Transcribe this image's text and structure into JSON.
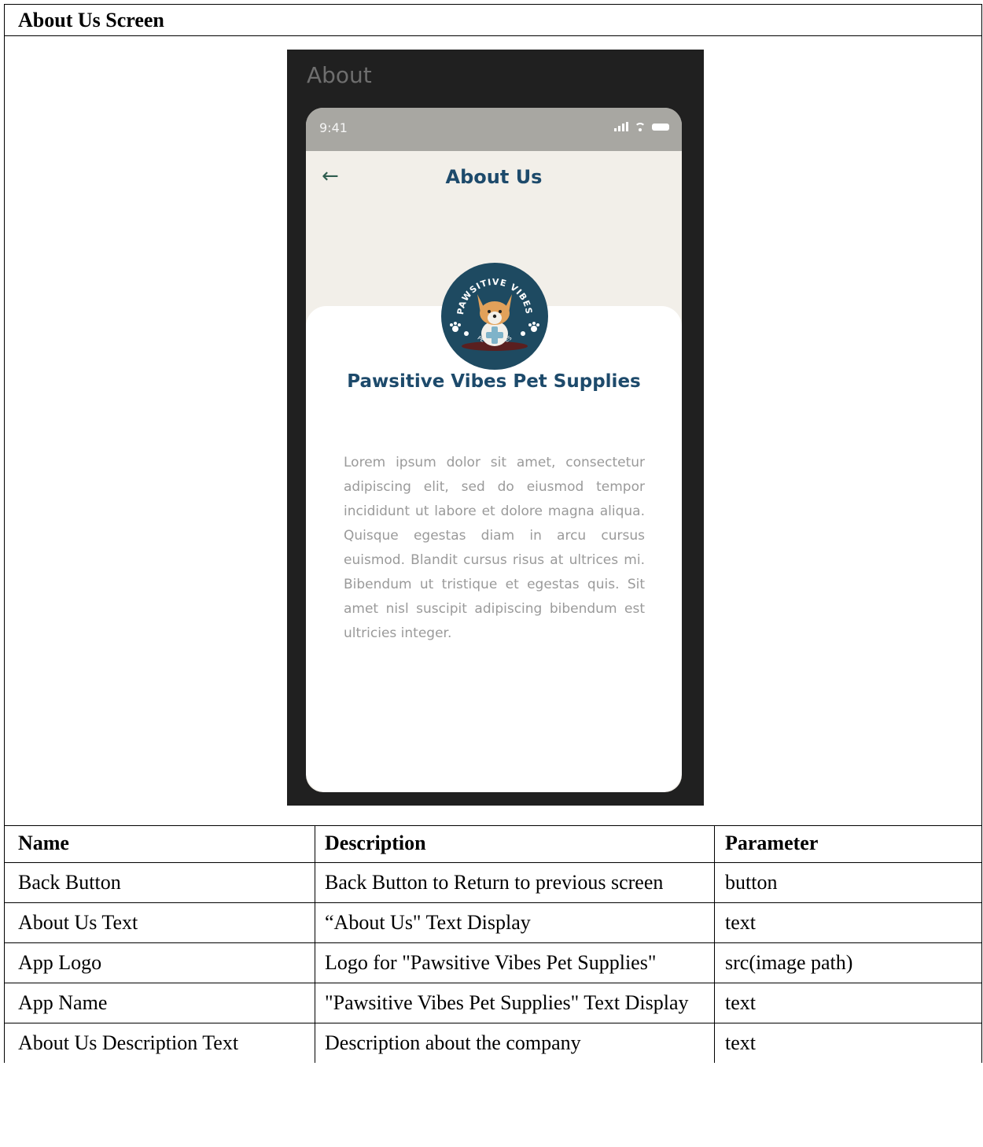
{
  "doc": {
    "title": "About Us Screen"
  },
  "mockup": {
    "frame_title": "About",
    "status_time": "9:41",
    "back_icon": "←",
    "nav_title": "About Us",
    "logo": {
      "icon": "pawsitive-vibes-logo",
      "top_text": "PAWSITIVE VIBES",
      "bottom_text": "PET SUPPLIES",
      "colors": {
        "circle": "#1e4a61",
        "dog": "#e2a15a"
      }
    },
    "app_name": "Pawsitive Vibes Pet Supplies",
    "description": "Lorem ipsum dolor sit amet, consectetur adipiscing elit, sed do eiusmod tempor incididunt ut labore et dolore magna aliqua. Quisque egestas diam in arcu cursus euismod. Blandit cursus risus at ultrices mi. Bibendum ut tristique et egestas quis. Sit amet nisl suscipit adipiscing bibendum est ultricies integer."
  },
  "table": {
    "headers": {
      "name": "Name",
      "description": "Description",
      "parameter": "Parameter"
    },
    "rows": [
      {
        "name": "Back Button",
        "description": "Back Button to Return to previous screen",
        "parameter": "button"
      },
      {
        "name": "About Us Text",
        "description": "“About Us\" Text Display",
        "parameter": "text"
      },
      {
        "name": "App Logo",
        "description": "Logo for \"Pawsitive Vibes Pet Supplies\"",
        "parameter": "src(image path)"
      },
      {
        "name": "App Name",
        "description": "\"Pawsitive Vibes Pet Supplies\" Text Display",
        "parameter": "text"
      },
      {
        "name": "About Us Description Text",
        "description": "Description about the company",
        "parameter": "text"
      }
    ]
  }
}
